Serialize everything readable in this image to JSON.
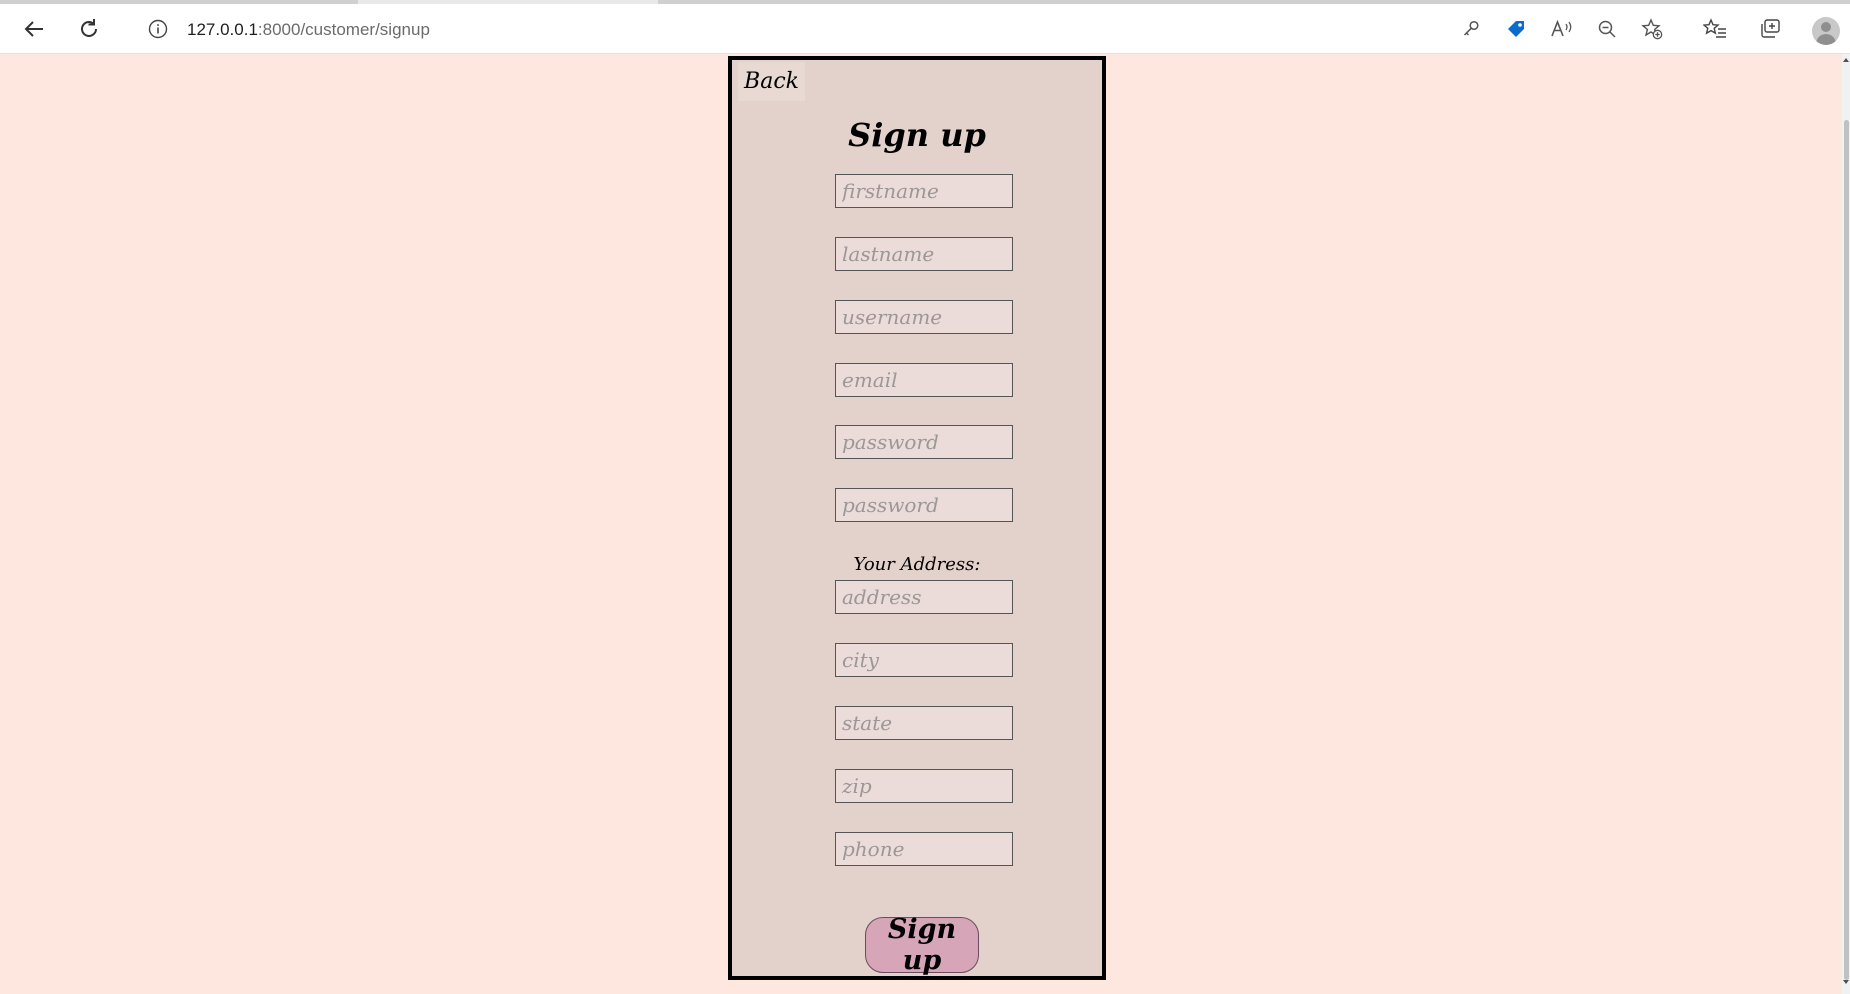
{
  "browser": {
    "url_host": "127.0.0.1",
    "url_path": ":8000/customer/signup"
  },
  "form": {
    "back_label": "Back",
    "title": "Sign up",
    "fields": {
      "firstname": "firstname",
      "lastname": "lastname",
      "username": "username",
      "email": "email",
      "password": "password",
      "password_confirm": "password",
      "address": "address",
      "city": "city",
      "state": "state",
      "zip": "zip",
      "phone": "phone"
    },
    "address_label": "Your Address:",
    "submit_label": "Sign up"
  },
  "colors": {
    "page_bg": "#fde7de",
    "card_bg": "#e3d1cb",
    "submit_bg": "#d6a6b8",
    "extension_accent": "#0a6ccc"
  }
}
